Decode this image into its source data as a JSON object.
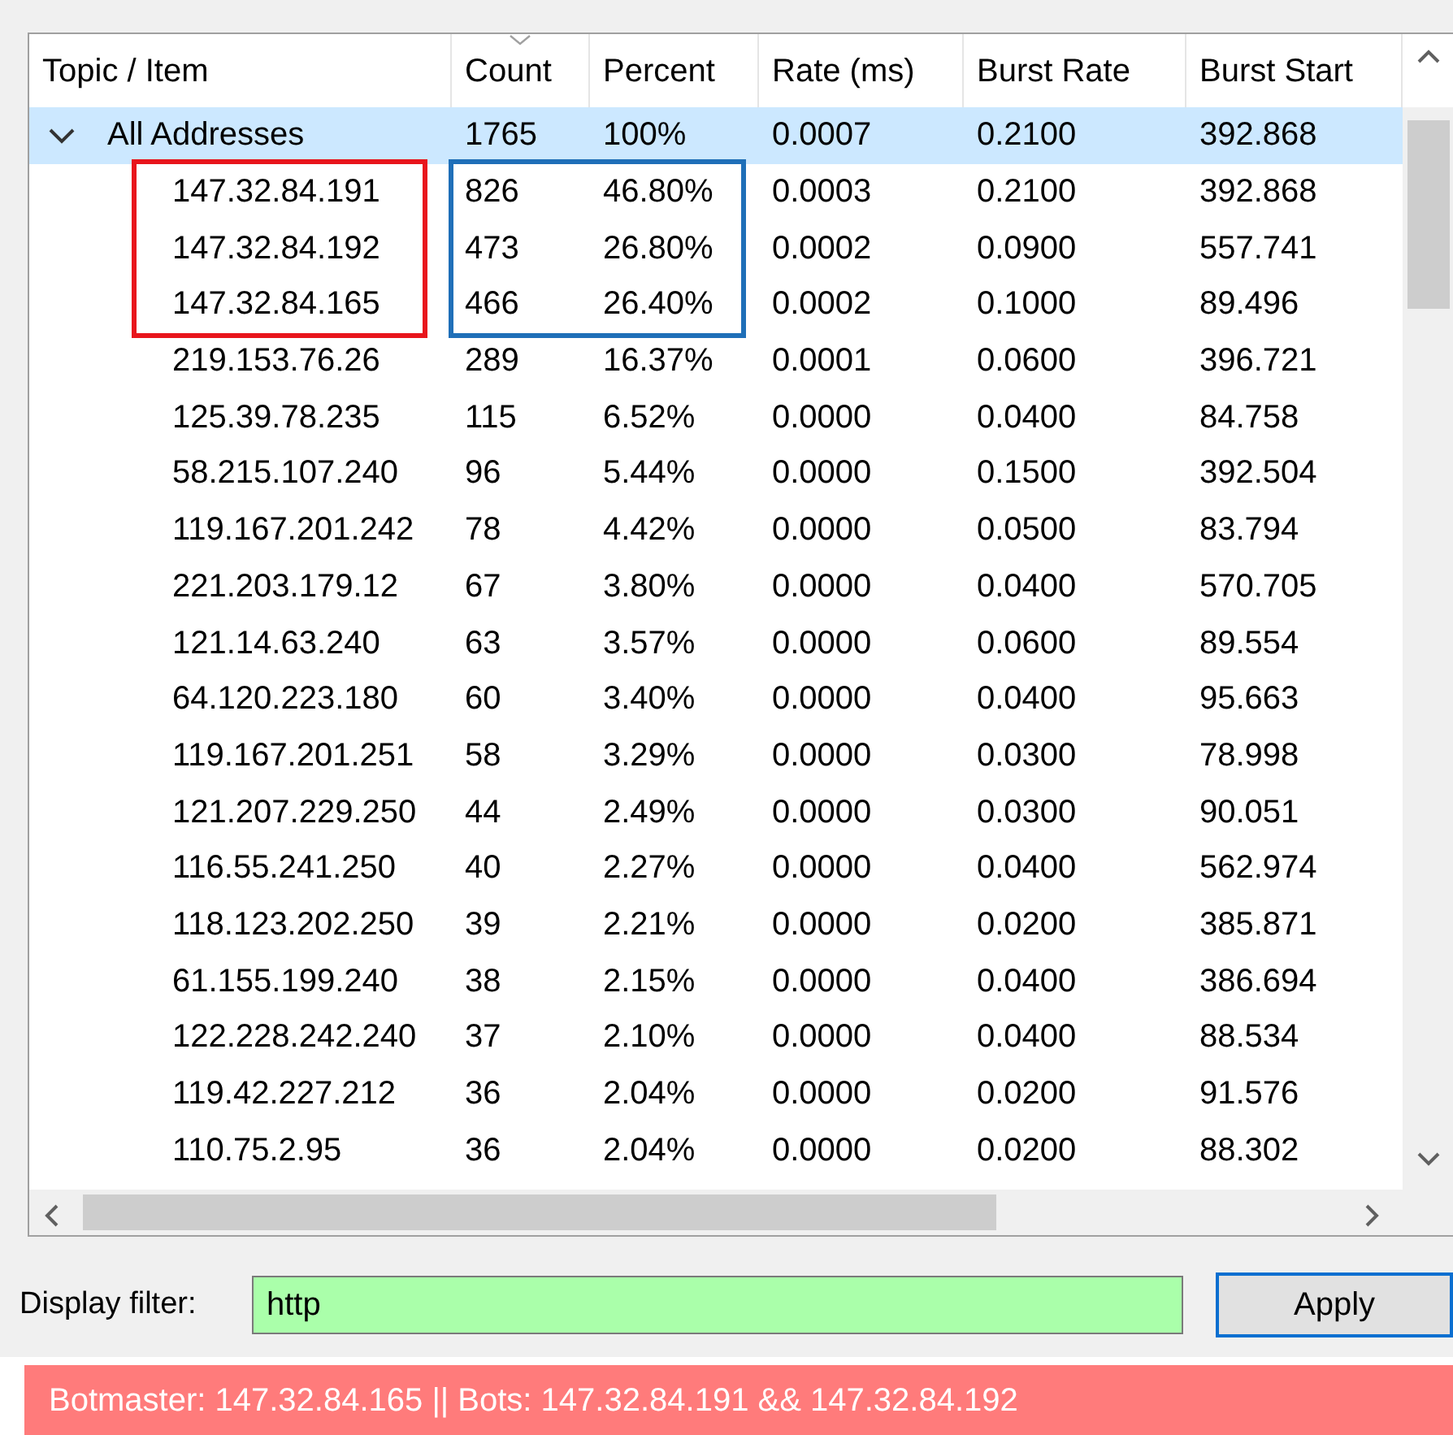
{
  "table": {
    "columns": [
      "Topic / Item",
      "Count",
      "Percent",
      "Rate (ms)",
      "Burst Rate",
      "Burst Start"
    ],
    "rows": [
      {
        "cells": [
          "All Addresses",
          "1765",
          "100%",
          "0.0007",
          "0.2100",
          "392.868"
        ],
        "expanded": true,
        "selected": true,
        "children": [
          {
            "cells": [
              "147.32.84.191",
              "826",
              "46.80%",
              "0.0003",
              "0.2100",
              "392.868"
            ],
            "marked": true
          },
          {
            "cells": [
              "147.32.84.192",
              "473",
              "26.80%",
              "0.0002",
              "0.0900",
              "557.741"
            ],
            "marked": true
          },
          {
            "cells": [
              "147.32.84.165",
              "466",
              "26.40%",
              "0.0002",
              "0.1000",
              "89.496"
            ],
            "marked": true
          },
          {
            "cells": [
              "219.153.76.26",
              "289",
              "16.37%",
              "0.0001",
              "0.0600",
              "396.721"
            ],
            "marked": false
          },
          {
            "cells": [
              "125.39.78.235",
              "115",
              "6.52%",
              "0.0000",
              "0.0400",
              "84.758"
            ],
            "marked": false
          },
          {
            "cells": [
              "58.215.107.240",
              "96",
              "5.44%",
              "0.0000",
              "0.1500",
              "392.504"
            ],
            "marked": false
          },
          {
            "cells": [
              "119.167.201.242",
              "78",
              "4.42%",
              "0.0000",
              "0.0500",
              "83.794"
            ],
            "marked": false
          },
          {
            "cells": [
              "221.203.179.12",
              "67",
              "3.80%",
              "0.0000",
              "0.0400",
              "570.705"
            ],
            "marked": false
          },
          {
            "cells": [
              "121.14.63.240",
              "63",
              "3.57%",
              "0.0000",
              "0.0600",
              "89.554"
            ],
            "marked": false
          },
          {
            "cells": [
              "64.120.223.180",
              "60",
              "3.40%",
              "0.0000",
              "0.0400",
              "95.663"
            ],
            "marked": false
          },
          {
            "cells": [
              "119.167.201.251",
              "58",
              "3.29%",
              "0.0000",
              "0.0300",
              "78.998"
            ],
            "marked": false
          },
          {
            "cells": [
              "121.207.229.250",
              "44",
              "2.49%",
              "0.0000",
              "0.0300",
              "90.051"
            ],
            "marked": false
          },
          {
            "cells": [
              "116.55.241.250",
              "40",
              "2.27%",
              "0.0000",
              "0.0400",
              "562.974"
            ],
            "marked": false
          },
          {
            "cells": [
              "118.123.202.250",
              "39",
              "2.21%",
              "0.0000",
              "0.0200",
              "385.871"
            ],
            "marked": false
          },
          {
            "cells": [
              "61.155.199.240",
              "38",
              "2.15%",
              "0.0000",
              "0.0400",
              "386.694"
            ],
            "marked": false
          },
          {
            "cells": [
              "122.228.242.240",
              "37",
              "2.10%",
              "0.0000",
              "0.0400",
              "88.534"
            ],
            "marked": false
          },
          {
            "cells": [
              "119.42.227.212",
              "36",
              "2.04%",
              "0.0000",
              "0.0200",
              "91.576"
            ],
            "marked": false
          },
          {
            "cells": [
              "110.75.2.95",
              "36",
              "2.04%",
              "0.0000",
              "0.0200",
              "88.302"
            ],
            "marked": false
          }
        ]
      }
    ]
  },
  "annotations": [
    {
      "kind": "topic",
      "color": "#e8151c"
    },
    {
      "kind": "count_percent",
      "color": "#1f6fb8"
    }
  ],
  "display_filter": {
    "label": "Display filter:",
    "value": "http"
  },
  "apply_button": "Apply",
  "banner": "Botmaster: 147.32.84.165 || Bots: 147.32.84.191 && 147.32.84.192"
}
